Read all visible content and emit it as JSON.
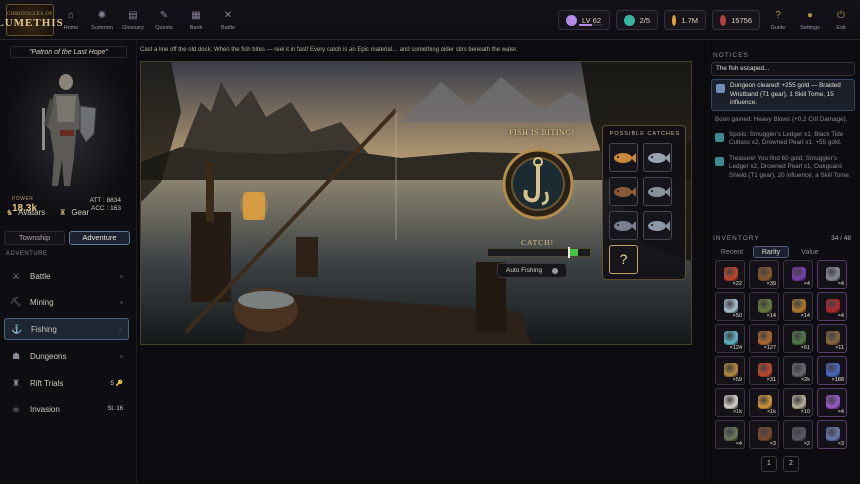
{
  "header": {
    "logo_line1": "CHRONICLES OF",
    "logo_line2": "LUMETHIS",
    "nav": [
      {
        "label": "Home",
        "icon": "home-icon",
        "glyph": "⌂"
      },
      {
        "label": "Summon",
        "icon": "summon-icon",
        "glyph": "✺"
      },
      {
        "label": "Glossary",
        "icon": "book-icon",
        "glyph": "▤"
      },
      {
        "label": "Quests",
        "icon": "scroll-icon",
        "glyph": "✎"
      },
      {
        "label": "Bank",
        "icon": "bank-icon",
        "glyph": "▦"
      },
      {
        "label": "Battle",
        "icon": "crossed-swords-icon",
        "glyph": "✕"
      }
    ],
    "level": "LV 62",
    "level_progress": 0.55,
    "keys": "2/5",
    "gold": "1.7M",
    "gems": "15756",
    "util": [
      {
        "label": "Guide",
        "icon": "question-icon",
        "glyph": "?"
      },
      {
        "label": "Settings",
        "icon": "settings-icon",
        "glyph": "●"
      },
      {
        "label": "Exit",
        "icon": "exit-icon",
        "glyph": "⏻"
      }
    ]
  },
  "hero": {
    "title": "\"Patron of the Last Hope\"",
    "power_label": "POWER",
    "power": "18.3k",
    "att": "ATT : 8834",
    "acc": "ACC : 163"
  },
  "left": {
    "tabs": [
      {
        "label": "Avatars",
        "icon": "avatar-icon",
        "glyph": "♞"
      },
      {
        "label": "Gear",
        "icon": "gear-armor-icon",
        "glyph": "♜"
      }
    ],
    "modes": [
      "Township",
      "Adventure"
    ],
    "section": "ADVENTURE",
    "menu": [
      {
        "label": "Battle",
        "icon": "sword-icon",
        "glyph": "⚔",
        "right": ""
      },
      {
        "label": "Mining",
        "icon": "pickaxe-icon",
        "glyph": "⛏",
        "right": ""
      },
      {
        "label": "Fishing",
        "icon": "fishing-rod-icon",
        "glyph": "⚓",
        "right": ""
      },
      {
        "label": "Dungeons",
        "icon": "dungeon-icon",
        "glyph": "☗",
        "right": ""
      },
      {
        "label": "Rift Trials",
        "icon": "rift-icon",
        "glyph": "♜",
        "right": "5 🔑"
      },
      {
        "label": "Invasion",
        "icon": "invasion-icon",
        "glyph": "☠",
        "right": "St. 16"
      }
    ]
  },
  "fishing": {
    "caption": "Cast a line off the old dock. When the fish bites — reel it in fast! Every catch is an Epic material… and something older stirs beneath the water.",
    "biting": "FISH IS BITING!",
    "catch_label": "CATCH!",
    "catch_progress": 0.8,
    "auto_label": "Auto Fishing",
    "possible_title": "POSSIBLE CATCHES",
    "unknown": "?"
  },
  "notices": {
    "title": "NOTICES",
    "items": [
      {
        "text": "The fish escaped...",
        "style": "first",
        "color": ""
      },
      {
        "text": "Dungeon cleared! +255 gold — Braided Wristband (T1 gear), 1 Skill Tome, 15 influence.",
        "style": "hi",
        "color": "#6f8db8"
      },
      {
        "text": "Boon gained: Heavy Blows (+0.2 Crit Damage).",
        "style": "plain",
        "color": ""
      },
      {
        "text": "Spoils: Smuggler's Ledger x1, Black Tide Cutlass x2, Drowned Pearl x1. +55 gold.",
        "style": "ic",
        "color": "#3c8a8a"
      },
      {
        "text": "Treasure! You find 60 gold, Smuggler's Ledger x2, Drowned Pearl x1, Oakguard Shield (T1 gear), 20 influence, a Skill Tome.",
        "style": "ic",
        "color": "#3c8a8a"
      }
    ]
  },
  "inventory": {
    "title": "INVENTORY",
    "count": "34 / 48",
    "tabs": [
      "Recent",
      "Rarity",
      "Value"
    ],
    "items": [
      {
        "q": "×22",
        "c": "#c4452b"
      },
      {
        "q": "×39",
        "c": "#8a5a2a"
      },
      {
        "q": "×4",
        "c": "#7d3fb0"
      },
      {
        "q": "×4",
        "c": "#8b8f9a"
      },
      {
        "q": "×50",
        "c": "#a8c4d4"
      },
      {
        "q": "×14",
        "c": "#6a7d3a"
      },
      {
        "q": "×14",
        "c": "#b07a2a"
      },
      {
        "q": "×4",
        "c": "#b8262a"
      },
      {
        "q": "×124",
        "c": "#5fb8c8"
      },
      {
        "q": "×127",
        "c": "#b46a2e"
      },
      {
        "q": "×61",
        "c": "#4f7a48"
      },
      {
        "q": "×11",
        "c": "#8a6a3a"
      },
      {
        "q": "×59",
        "c": "#b88a3a"
      },
      {
        "q": "×31",
        "c": "#c44a2a"
      },
      {
        "q": "×2k",
        "c": "#6a6670"
      },
      {
        "q": "×188",
        "c": "#4a6ac8"
      },
      {
        "q": "×1k",
        "c": "#d8d4cc"
      },
      {
        "q": "×1k",
        "c": "#d49a3a"
      },
      {
        "q": "×10",
        "c": "#b8b29a"
      },
      {
        "q": "×4",
        "c": "#9a5ad0"
      },
      {
        "q": "×4",
        "c": "#6a7a5a"
      },
      {
        "q": "×3",
        "c": "#7a4a2a"
      },
      {
        "q": "×2",
        "c": "#5a5a66"
      },
      {
        "q": "×3",
        "c": "#6a7ab0"
      }
    ],
    "pages": [
      "1",
      "2"
    ]
  },
  "catches": [
    {
      "name": "golden-fish-icon",
      "c": "#c88a3a"
    },
    {
      "name": "silver-fish-icon",
      "c": "#9aa4b0"
    },
    {
      "name": "eel-icon",
      "c": "#8a5a3a"
    },
    {
      "name": "striped-fish-icon",
      "c": "#8a9099"
    },
    {
      "name": "shark-icon",
      "c": "#7a8090"
    },
    {
      "name": "blue-fish-icon",
      "c": "#8a98a6"
    }
  ],
  "colors": {
    "accent": "#e7c57f",
    "highlight": "#4a6384",
    "catch_zone": "#47c24b"
  }
}
